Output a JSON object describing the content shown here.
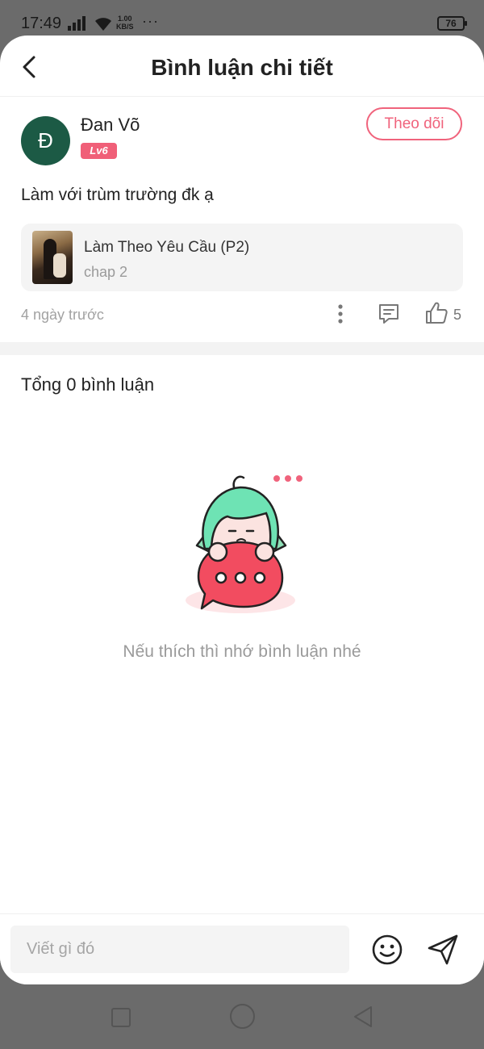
{
  "status_bar": {
    "time": "17:49",
    "speed_value": "1.00",
    "speed_unit": "KB/S",
    "more": "···",
    "battery": "76"
  },
  "header": {
    "title": "Bình luận chi tiết"
  },
  "comment": {
    "avatar_letter": "Đ",
    "avatar_color": "#1c5a45",
    "username": "Đan Võ",
    "level": "Lv6",
    "follow_label": "Theo dõi",
    "text": "Làm với trùm trường đk ạ",
    "manga": {
      "title": "Làm Theo Yêu Cầu (P2)",
      "chapter": "chap 2"
    },
    "time_ago": "4 ngày trước",
    "like_count": "5"
  },
  "replies": {
    "total_label": "Tổng 0 bình luận",
    "empty_message": "Nếu thích thì nhớ bình luận nhé"
  },
  "input": {
    "placeholder": "Viết gì đó"
  },
  "colors": {
    "accent": "#f0637c",
    "level_badge": "#f05f78"
  }
}
